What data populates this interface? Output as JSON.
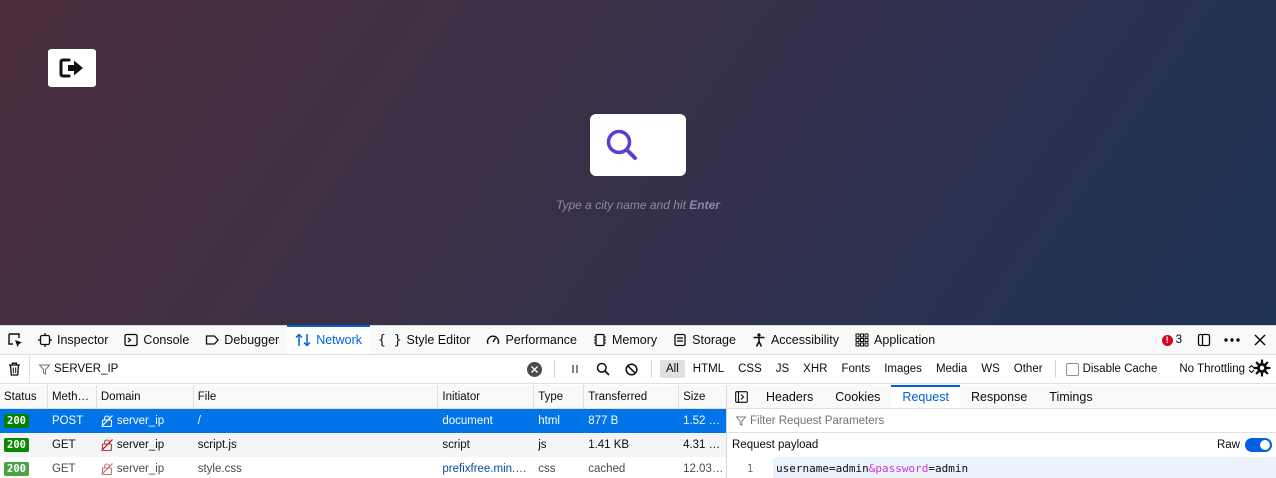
{
  "page": {
    "hint_prefix": "Type a city name and hit ",
    "hint_key": "Enter"
  },
  "devtools": {
    "tabs": [
      {
        "label": "Inspector"
      },
      {
        "label": "Console"
      },
      {
        "label": "Debugger"
      },
      {
        "label": "Network"
      },
      {
        "label": "Style Editor"
      },
      {
        "label": "Performance"
      },
      {
        "label": "Memory"
      },
      {
        "label": "Storage"
      },
      {
        "label": "Accessibility"
      },
      {
        "label": "Application"
      }
    ],
    "active_tab": "Network",
    "error_count": "3",
    "filter": {
      "value": "SERVER_IP"
    },
    "type_filters": [
      "All",
      "HTML",
      "CSS",
      "JS",
      "XHR",
      "Fonts",
      "Images",
      "Media",
      "WS",
      "Other"
    ],
    "active_type_filter": "All",
    "disable_cache_label": "Disable Cache",
    "throttling_label": "No Throttling"
  },
  "requests": {
    "columns": [
      "Status",
      "Meth…",
      "Domain",
      "File",
      "Initiator",
      "Type",
      "Transferred",
      "Size"
    ],
    "rows": [
      {
        "status": "200",
        "method": "POST",
        "domain": "server_ip",
        "file": "/",
        "initiator": "document",
        "type": "html",
        "transferred": "877 B",
        "size": "1.52 …"
      },
      {
        "status": "200",
        "method": "GET",
        "domain": "server_ip",
        "file": "script.js",
        "initiator": "script",
        "type": "js",
        "transferred": "1.41 KB",
        "size": "4.31 …"
      },
      {
        "status": "200",
        "method": "GET",
        "domain": "server_ip",
        "file": "style.css",
        "initiator": "prefixfree.min.…",
        "type": "css",
        "transferred": "cached",
        "size": "12.03…"
      }
    ]
  },
  "details": {
    "tabs": [
      "Headers",
      "Cookies",
      "Request",
      "Response",
      "Timings"
    ],
    "active_tab": "Request",
    "filter_placeholder": "Filter Request Parameters",
    "payload_title": "Request payload",
    "raw_label": "Raw",
    "raw_enabled": true,
    "payload_line_number": "1",
    "payload_parts": [
      "username=admin",
      "&password",
      "=admin"
    ]
  },
  "colors": {
    "accent": "#0060df",
    "selected_row": "#0074e8",
    "status_ok": "#058b00",
    "search_icon": "#5a3fd1"
  }
}
